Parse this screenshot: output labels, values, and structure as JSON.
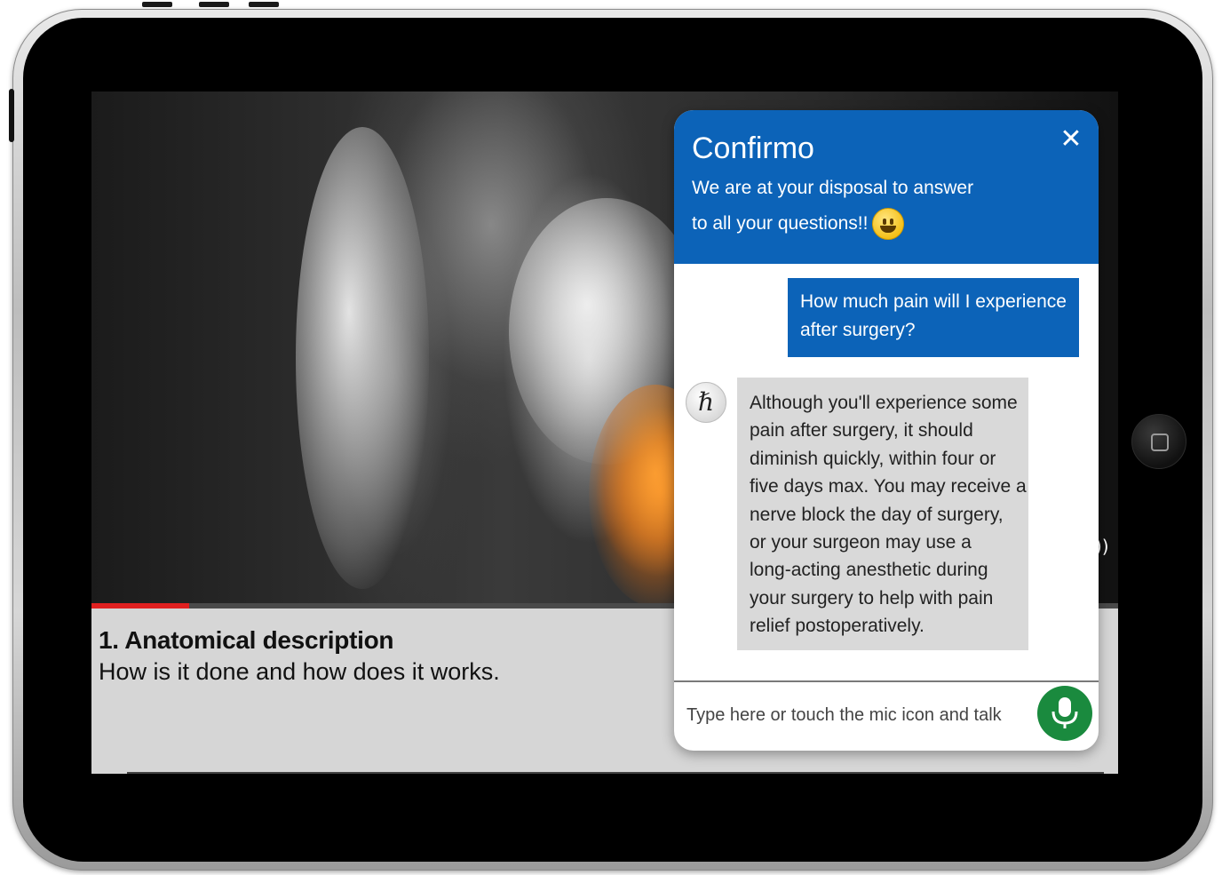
{
  "chat": {
    "title": "Confirmo",
    "subtitle_line1": "We are at your disposal to answer",
    "subtitle_line2": "to all your questions!!",
    "close_glyph": "✕",
    "user_message_lines": [
      "How much pain will I experience",
      "after surgery?"
    ],
    "bot_avatar_glyph": "ℏ",
    "bot_message_lines": [
      "Although you'll experience some",
      "pain after surgery, it should",
      "diminish quickly, within four or",
      "five days max. You may receive a",
      "nerve block the day of surgery,",
      "or your surgeon may use a",
      "long-acting anesthetic during",
      "your surgery to help with pain",
      "relief postoperatively."
    ],
    "input_placeholder": "Type here or touch the mic icon and talk"
  },
  "video": {
    "caption_title": "1. Anatomical description",
    "caption_subtitle": "How is it done and how does it works.",
    "progress_fraction": 0.095,
    "volume_glyph": "))"
  },
  "colors": {
    "chat_header": "#0c63b8",
    "user_bubble": "#0c63b8",
    "bot_bubble": "#d9d9d9",
    "mic_button": "#1a8a3e",
    "progress": "#e02020",
    "caption_bg": "#d6d6d6"
  },
  "icons": {
    "close": "close-icon",
    "emoji": "smiley-emoji-icon",
    "mic": "microphone-icon",
    "home": "home-button-icon",
    "volume": "volume-icon"
  }
}
